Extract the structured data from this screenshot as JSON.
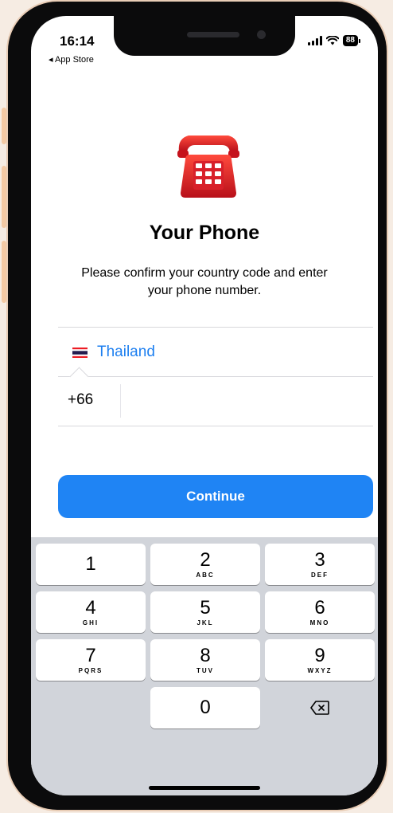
{
  "status_bar": {
    "time": "16:14",
    "back_app": "◂ App Store",
    "battery": "88"
  },
  "icons": {
    "phone_illustration": "telephone-icon",
    "flag": "thailand-flag-icon",
    "delete": "backspace-icon"
  },
  "main": {
    "title": "Your Phone",
    "subtitle": "Please confirm your country code and enter your phone number.",
    "country": "Thailand",
    "dial_code": "+66",
    "phone_value": "",
    "continue_label": "Continue"
  },
  "colors": {
    "accent": "#1f84f4",
    "link": "#1d7ff0",
    "keyboard_bg": "#d1d4da"
  },
  "keypad": [
    {
      "digit": "1",
      "letters": ""
    },
    {
      "digit": "2",
      "letters": "ABC"
    },
    {
      "digit": "3",
      "letters": "DEF"
    },
    {
      "digit": "4",
      "letters": "GHI"
    },
    {
      "digit": "5",
      "letters": "JKL"
    },
    {
      "digit": "6",
      "letters": "MNO"
    },
    {
      "digit": "7",
      "letters": "PQRS"
    },
    {
      "digit": "8",
      "letters": "TUV"
    },
    {
      "digit": "9",
      "letters": "WXYZ"
    },
    {
      "digit": "0",
      "letters": ""
    }
  ]
}
